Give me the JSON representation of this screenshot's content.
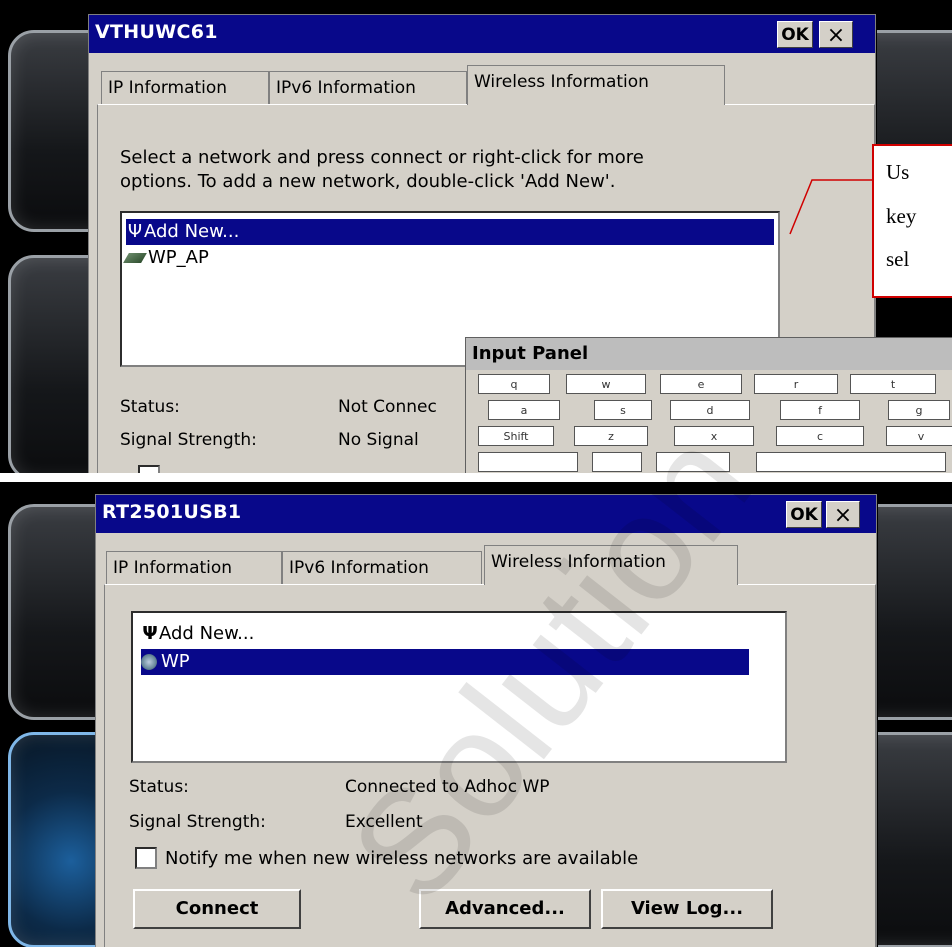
{
  "top": {
    "dialog_title": "VTHUWC61",
    "ok_label": "OK",
    "close_label": "×",
    "tabs": [
      "IP Information",
      "IPv6 Information",
      "Wireless Information"
    ],
    "instructions": [
      "Select a network and press connect or right-click for more",
      "options.  To add a new network, double-click 'Add New'."
    ],
    "networks": [
      {
        "icon": "antenna-icon",
        "label": "Add New..."
      },
      {
        "icon": "wireless-card-icon",
        "label": "WP_AP"
      }
    ],
    "status_label": "Status:",
    "status_value": "Not Connec",
    "signal_label": "Signal Strength:",
    "signal_value": "No Signal",
    "callout_lines": [
      "Us",
      "key",
      "sel"
    ],
    "input_panel": {
      "title": "Input Panel",
      "rows": [
        [
          "q",
          "w",
          "e",
          "r",
          "t"
        ],
        [
          "a",
          "s",
          "d",
          "f",
          "g"
        ],
        [
          "Shift",
          "z",
          "x",
          "c",
          "v"
        ]
      ]
    }
  },
  "bottom": {
    "dialog_title": "RT2501USB1",
    "ok_label": "OK",
    "close_label": "×",
    "tabs": [
      "IP Information",
      "IPv6 Information",
      "Wireless Information"
    ],
    "networks": [
      {
        "icon": "antenna-icon",
        "label": "Add New..."
      },
      {
        "icon": "adhoc-network-icon",
        "label": "WP"
      }
    ],
    "status_label": "Status:",
    "status_value": "Connected to Adhoc WP",
    "signal_label": "Signal Strength:",
    "signal_value": "Excellent",
    "notify_label": "Notify me when new wireless networks are available",
    "notify_checked": false,
    "buttons": {
      "connect": "Connect",
      "advanced": "Advanced...",
      "view_log": "View Log..."
    }
  },
  "watermark": "Solution"
}
